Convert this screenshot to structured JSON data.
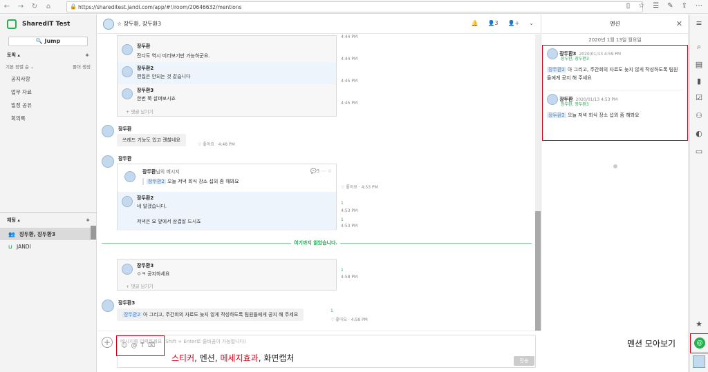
{
  "browser": {
    "url": "https://shareditest.jandi.com/app/#!/room/20646632/mentions"
  },
  "sidebar": {
    "team_name": "SharedIT Test",
    "jump_label": "Jump",
    "topics_label": "토픽 ▴",
    "sort_label": "기본 정렬 순 ⌄",
    "folder_label": "폴더 생성",
    "topics": [
      "공지사항",
      "업무 자료",
      "일정 공유",
      "회의록"
    ],
    "chats_label": "채팅 ▴",
    "chats": [
      "장두환, 장두환3",
      "JANDI"
    ]
  },
  "chat": {
    "room_title": "☆ 장두환, 장두환3",
    "member_count": "3",
    "messages": {
      "t1_time": "4:44 PM",
      "t1_sender": "장두환",
      "t1_text": "잔디도 역시 미리보기만 가능하군요.",
      "t1_time2": "4:44 PM",
      "t2_sender": "장두환2",
      "t2_text": "편집은 안되는 것 같습니다",
      "t2_time": "4:45 PM",
      "t3_sender": "장두환3",
      "t3_text": "한번 쭉 살펴보시죠",
      "t3_time": "4:45 PM",
      "reply_label": "댓글 남기기",
      "m1_sender": "장두환",
      "m1_text": "쓰레드 기능도 있고 괜찮네요",
      "m1_like": "좋아요",
      "m1_time": "4:48 PM",
      "m2_sender": "장두환",
      "m2_quote_sender": "장두환",
      "m2_quote_suffix": "님의 메시지",
      "m2_quote_count": "3",
      "m2_mention": "장두환2",
      "m2_quote_text": "오늘 저녁 회식 장소 섭외 좀 해봐요",
      "m2_like": "좋아요",
      "m2_time": "4:53 PM",
      "m2_reply_sender": "장두환2",
      "m2_reply_text": "네 알겠습니다.",
      "m2_reply_count": "1",
      "m2_reply_time": "4:53 PM",
      "m2_reply2_text": "저녁은 요 앞에서 삼겹살 드시죠",
      "m2_reply2_count": "1",
      "m2_reply2_time": "4:58 PM",
      "read_divider": "여기까지 읽었습니다.",
      "t4_sender": "장두환3",
      "t4_text": "ㅇㅋ 공지하세요",
      "t4_count": "1",
      "t4_time": "4:58 PM",
      "m3_sender": "장두환3",
      "m3_mention": "장두환2",
      "m3_text": "아 그리고, 주간회의 자료도 늦지 않게 작성하도록 팀원들에게 공지 해 주세요",
      "m3_count": "1",
      "m3_like": "좋아요",
      "m3_time": "4:58 PM"
    },
    "composer_placeholder": "메시지를 입력하세요 (Shift + Enter로 줄바꿈이 가능합니다)",
    "send_label": "전송",
    "tool_icons": [
      "☺",
      "@",
      "T",
      "⌧"
    ]
  },
  "annotations": {
    "tools_sticker": "스티커",
    "tools_sep1": ", ",
    "tools_mention": "멘션",
    "tools_sep2": ", ",
    "tools_effect": "메세지효과",
    "tools_sep3": ", ",
    "tools_capture": "화면캡처",
    "mention_view": "멘션 모아보기"
  },
  "mention_panel": {
    "title": "멘션",
    "date": "2020년 1월 13일 월요일",
    "items": [
      {
        "sender": "장두환3",
        "time": "2020/01/13 4:59 PM",
        "room": "장두환, 장두환3",
        "mention": "장두환2",
        "text": " 아 그리고, 주간회의 자료도 늦지 않게 작성하도록 팀원들에게 공지 해 주세요"
      },
      {
        "sender": "장두환",
        "time": "2020/01/13 4:53 PM",
        "room": "장두환, 장두환3",
        "mention": "장두환2",
        "text": " 오늘 저녁 회식 장소 섭외 좀 해봐요"
      }
    ]
  },
  "colors": {
    "accent": "#23b14d",
    "annotation_red": "#d0021b",
    "mention_bg": "#dfeaf7"
  }
}
